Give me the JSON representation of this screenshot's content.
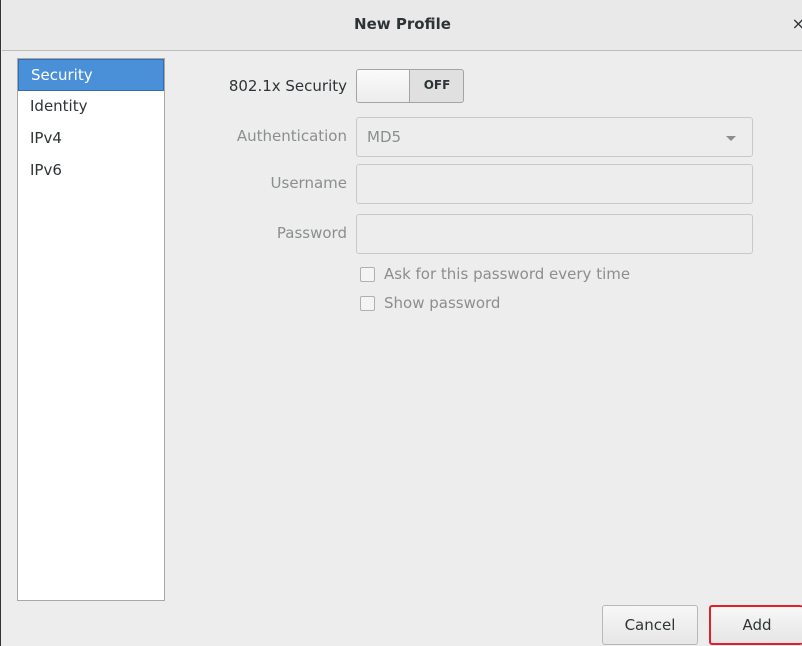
{
  "window": {
    "title": "New Profile",
    "close_glyph": "×"
  },
  "sidebar": {
    "items": [
      {
        "label": "Security",
        "selected": true
      },
      {
        "label": "Identity",
        "selected": false
      },
      {
        "label": "IPv4",
        "selected": false
      },
      {
        "label": "IPv6",
        "selected": false
      }
    ]
  },
  "form": {
    "security_label": "802.1x Security",
    "security_toggle_state": "OFF",
    "auth_label": "Authentication",
    "auth_value": "MD5",
    "username_label": "Username",
    "username_value": "",
    "password_label": "Password",
    "password_value": "",
    "ask_password_label": "Ask for this password every time",
    "ask_password_checked": false,
    "show_password_label": "Show password",
    "show_password_checked": false
  },
  "footer": {
    "cancel_label": "Cancel",
    "add_label": "Add"
  },
  "colors": {
    "selection": "#4a90d9",
    "highlight_border": "#e0202a"
  }
}
